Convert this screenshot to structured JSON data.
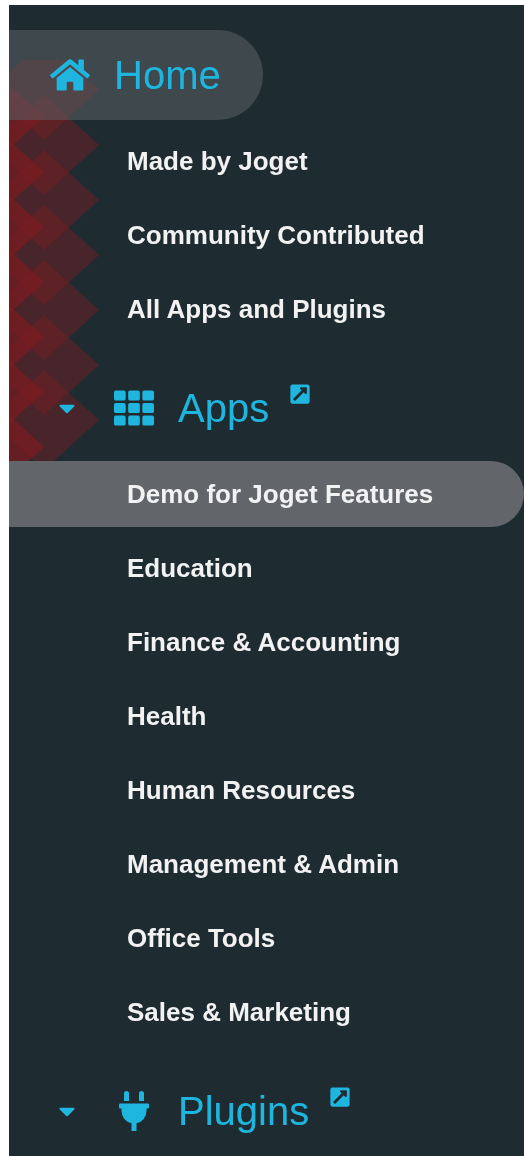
{
  "sections": [
    {
      "label": "Home",
      "selected": true,
      "external": false,
      "items": [
        {
          "label": "Made by Joget",
          "selected": false
        },
        {
          "label": "Community Contributed",
          "selected": false
        },
        {
          "label": "All Apps and Plugins",
          "selected": false
        }
      ]
    },
    {
      "label": "Apps",
      "selected": false,
      "expanded": true,
      "external": true,
      "items": [
        {
          "label": "Demo for Joget Features",
          "selected": true
        },
        {
          "label": "Education",
          "selected": false
        },
        {
          "label": "Finance & Accounting",
          "selected": false
        },
        {
          "label": "Health",
          "selected": false
        },
        {
          "label": "Human Resources",
          "selected": false
        },
        {
          "label": "Management & Admin",
          "selected": false
        },
        {
          "label": "Office Tools",
          "selected": false
        },
        {
          "label": "Sales & Marketing",
          "selected": false
        }
      ]
    },
    {
      "label": "Plugins",
      "selected": false,
      "expanded": true,
      "external": true
    }
  ]
}
